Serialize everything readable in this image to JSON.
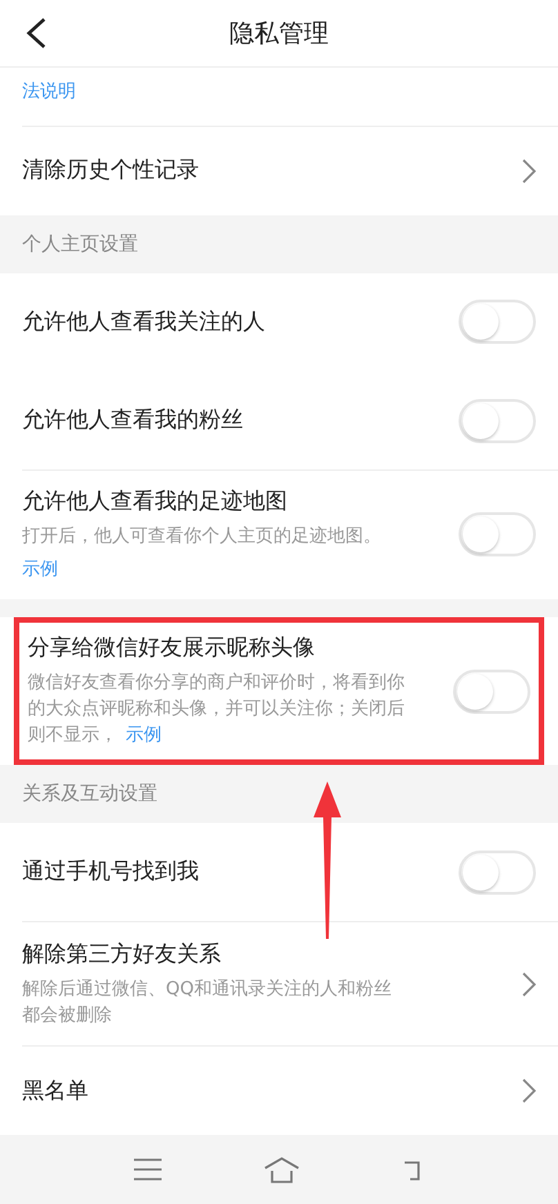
{
  "header": {
    "title": "隐私管理"
  },
  "top_link": "法说明",
  "sections": [
    {
      "items": [
        {
          "kind": "link",
          "title": "清除历史个性记录"
        }
      ]
    },
    {
      "heading": "个人主页设置",
      "items": [
        {
          "kind": "toggle",
          "title": "允许他人查看我关注的人",
          "on": false
        },
        {
          "kind": "toggle",
          "title": "允许他人查看我的粉丝",
          "on": false
        },
        {
          "kind": "toggle",
          "title": "允许他人查看我的足迹地图",
          "description": "打开后，他人可查看你个人主页的足迹地图。",
          "link": "示例",
          "on": false
        }
      ]
    },
    {
      "items": [
        {
          "kind": "toggle",
          "title": "分享给微信好友展示昵称头像",
          "description": "微信好友查看你分享的商户和评价时，将看到你的大众点评昵称和头像，并可以关注你；关闭后则不显示，",
          "link": "示例",
          "on": false,
          "highlighted": true
        }
      ]
    },
    {
      "heading": "关系及互动设置",
      "items": [
        {
          "kind": "toggle",
          "title": "通过手机号找到我",
          "on": false
        },
        {
          "kind": "link",
          "title": "解除第三方好友关系",
          "description": "解除后通过微信、QQ和通讯录关注的人和粉丝都会被删除"
        },
        {
          "kind": "link",
          "title": "黑名单"
        }
      ]
    }
  ]
}
